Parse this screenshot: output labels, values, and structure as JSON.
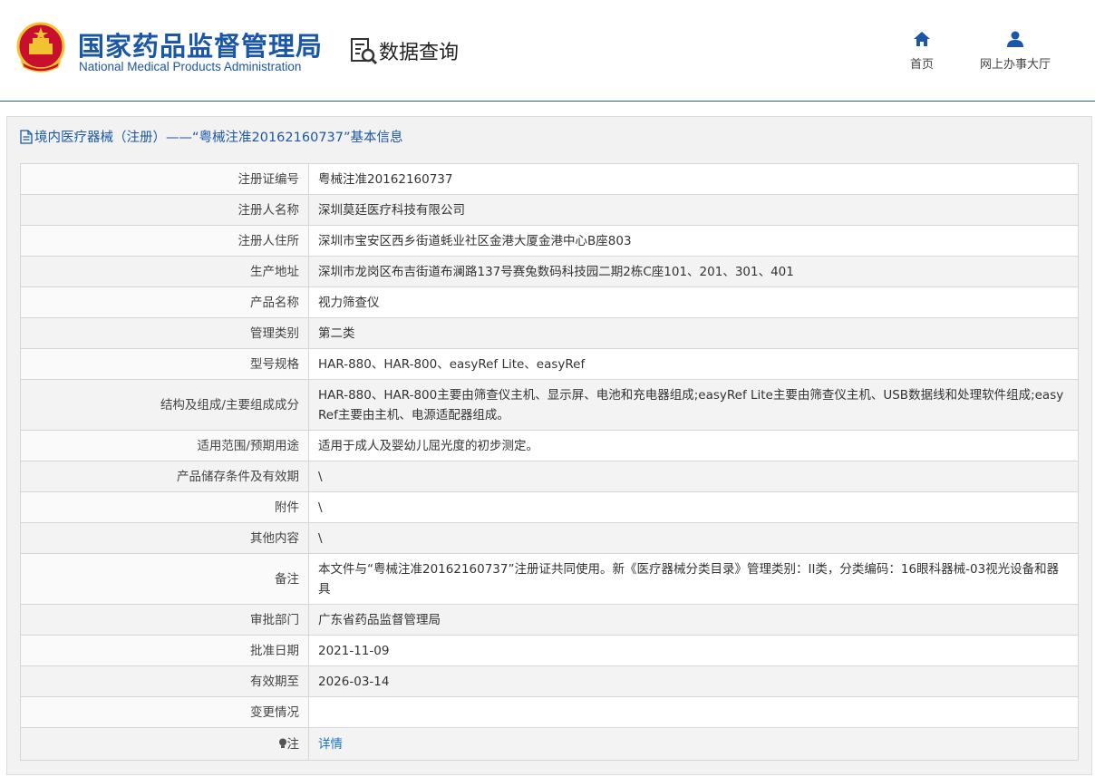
{
  "header": {
    "logo_cn": "国家药品监督管理局",
    "logo_en": "National Medical Products Administration",
    "section_title": "数据查询",
    "nav": [
      {
        "label": "首页",
        "icon": "home-icon"
      },
      {
        "label": "网上办事大厅",
        "icon": "user-icon"
      }
    ]
  },
  "panel": {
    "title": "境内医疗器械（注册）——“粤械注准20162160737”基本信息"
  },
  "table": {
    "rows": [
      {
        "key": "注册证编号",
        "value": "粤械注准20162160737"
      },
      {
        "key": "注册人名称",
        "value": "深圳莫廷医疗科技有限公司"
      },
      {
        "key": "注册人住所",
        "value": "深圳市宝安区西乡街道蚝业社区金港大厦金港中心B座803"
      },
      {
        "key": "生产地址",
        "value": "深圳市龙岗区布吉街道布澜路137号赛兔数码科技园二期2栋C座101、201、301、401"
      },
      {
        "key": "产品名称",
        "value": "视力筛查仪"
      },
      {
        "key": "管理类别",
        "value": "第二类"
      },
      {
        "key": "型号规格",
        "value": "HAR-880、HAR-800、easyRef Lite、easyRef"
      },
      {
        "key": "结构及组成/主要组成成分",
        "value": "HAR-880、HAR-800主要由筛查仪主机、显示屏、电池和充电器组成;easyRef Lite主要由筛查仪主机、USB数据线和处理软件组成;easyRef主要由主机、电源适配器组成。"
      },
      {
        "key": "适用范围/预期用途",
        "value": "适用于成人及婴幼儿屈光度的初步测定。"
      },
      {
        "key": "产品储存条件及有效期",
        "value": "\\"
      },
      {
        "key": "附件",
        "value": "\\"
      },
      {
        "key": "其他内容",
        "value": "\\"
      },
      {
        "key": "备注",
        "value": "本文件与“粤械注准20162160737”注册证共同使用。新《医疗器械分类目录》管理类别：II类，分类编码：16眼科器械-03视光设备和器具"
      },
      {
        "key": "审批部门",
        "value": "广东省药品监督管理局"
      },
      {
        "key": "批准日期",
        "value": "2021-11-09"
      },
      {
        "key": "有效期至",
        "value": "2026-03-14"
      },
      {
        "key": "变更情况",
        "value": ""
      },
      {
        "key": "注",
        "value": "详情"
      }
    ]
  },
  "colors": {
    "brand_blue": "#1a57a6",
    "link_blue": "#1a73c8"
  }
}
